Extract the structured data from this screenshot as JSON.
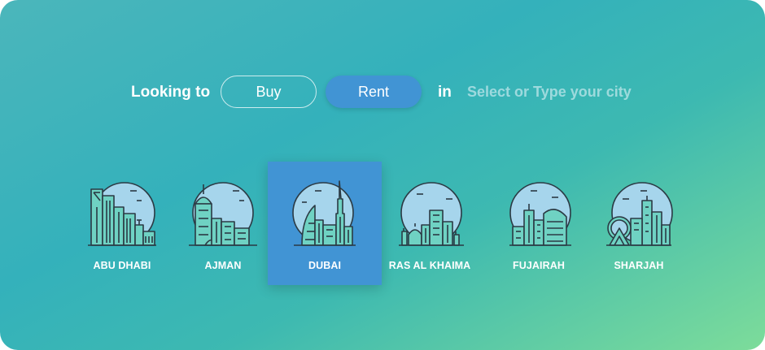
{
  "search": {
    "prefix_label": "Looking to",
    "buy_label": "Buy",
    "rent_label": "Rent",
    "active_mode": "Rent",
    "in_label": "in",
    "city_placeholder": "Select or Type your city",
    "city_value": ""
  },
  "cities": [
    {
      "label": "ABU DHABI",
      "icon": "abu-dhabi-skyline-icon"
    },
    {
      "label": "AJMAN",
      "icon": "ajman-skyline-icon"
    },
    {
      "label": "DUBAI",
      "icon": "dubai-skyline-icon"
    },
    {
      "label": "RAS AL KHAIMA",
      "icon": "ras-al-khaima-skyline-icon"
    },
    {
      "label": "FUJAIRAH",
      "icon": "fujairah-skyline-icon"
    },
    {
      "label": "SHARJAH",
      "icon": "sharjah-skyline-icon"
    }
  ],
  "selected_city": "DUBAI",
  "colors": {
    "accent": "#4194d4",
    "gradient_start": "#4bb6bb",
    "gradient_end": "#7ddc9a",
    "icon_sky": "#a6d5ec",
    "icon_building": "#6fd2c3",
    "icon_stroke": "#2b3a44"
  }
}
